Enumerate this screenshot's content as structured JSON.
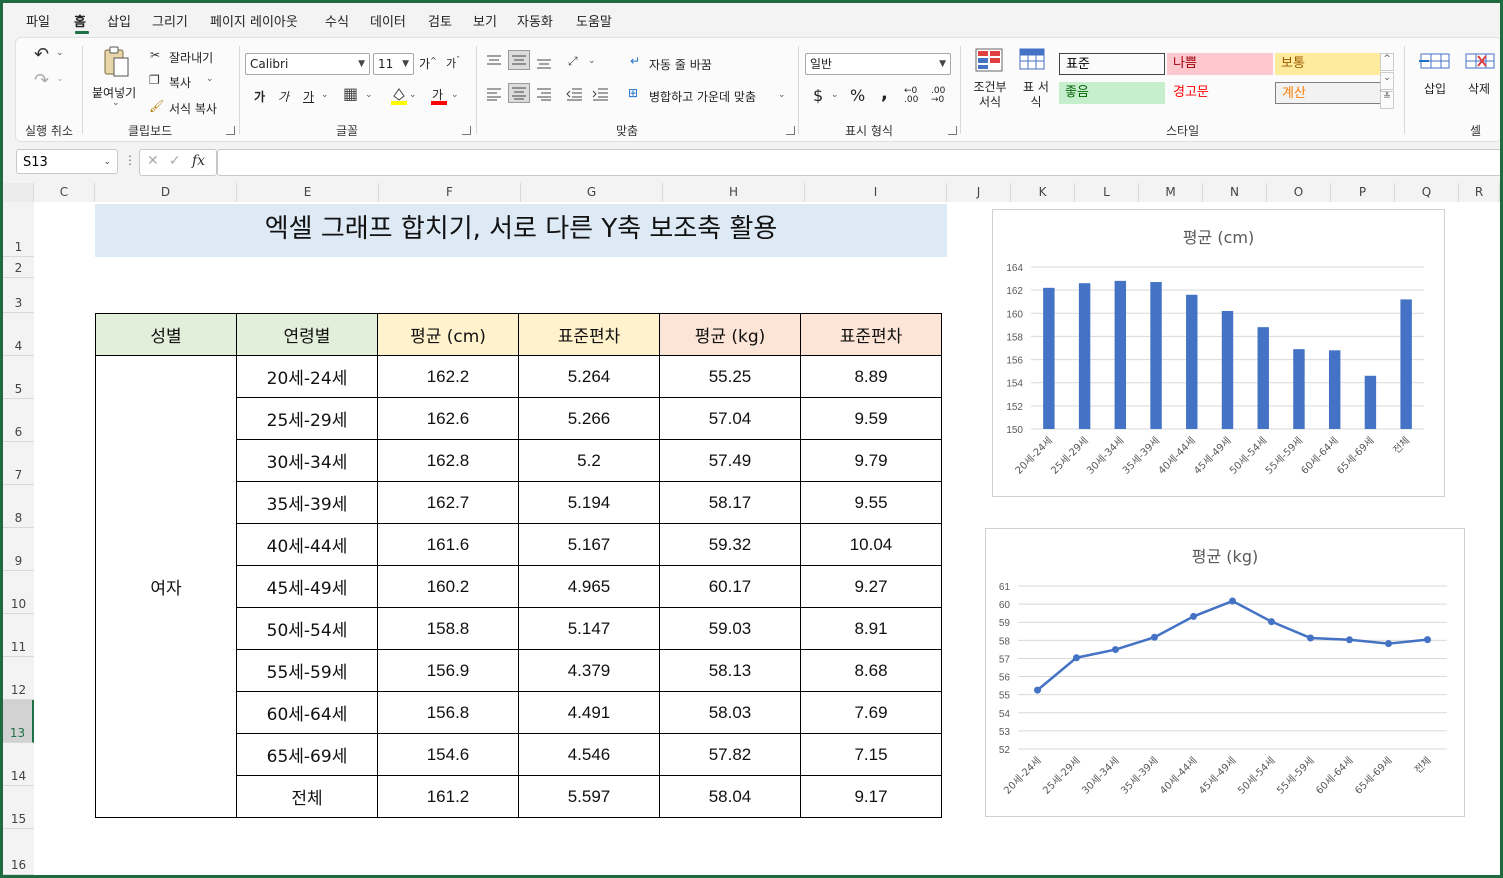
{
  "menu": [
    "파일",
    "홈",
    "삽입",
    "그리기",
    "페이지 레이아웃",
    "수식",
    "데이터",
    "검토",
    "보기",
    "자동화",
    "도움말"
  ],
  "ribbon": {
    "undo_group": "실행 취소",
    "clipboard": {
      "paste": "붙여넣기",
      "cut": "잘라내기",
      "copy": "복사",
      "format_painter": "서식 복사",
      "group": "클립보드"
    },
    "font": {
      "name": "Calibri",
      "size": "11",
      "group": "글꼴",
      "grow": "가",
      "shrink": "가",
      "bold": "가",
      "italic": "가",
      "underline": "가",
      "font_color_label": "가"
    },
    "alignment": {
      "wrap": "자동 줄 바꿈",
      "merge": "병합하고 가운데 맞춤",
      "group": "맞춤"
    },
    "number": {
      "format": "일반",
      "currency": "$",
      "percent": "%",
      "comma": ",",
      "group": "표시 형식"
    },
    "styles": {
      "conditional": "조건부 서식",
      "table": "표 서식",
      "cells": [
        {
          "label": "표준",
          "bg": "#ffffff",
          "color": "#000000"
        },
        {
          "label": "나쁨",
          "bg": "#ffc7ce",
          "color": "#9c0006"
        },
        {
          "label": "보통",
          "bg": "#ffeb9c",
          "color": "#9c5700"
        },
        {
          "label": "좋음",
          "bg": "#c6efce",
          "color": "#006100"
        },
        {
          "label": "경고문",
          "bg": "#ffffff",
          "color": "#ff0000"
        },
        {
          "label": "계산",
          "bg": "#f2f2f2",
          "color": "#fa7d00"
        }
      ],
      "group": "스타일"
    },
    "cells_group": {
      "insert": "삽입",
      "delete": "삭제",
      "group": "셀"
    }
  },
  "formula_bar": {
    "name_box": "S13",
    "fx": "fx",
    "value": ""
  },
  "columns": [
    "C",
    "D",
    "E",
    "F",
    "G",
    "H",
    "I",
    "J",
    "K",
    "L",
    "M",
    "N",
    "O",
    "P",
    "Q",
    "R"
  ],
  "rows": [
    "1",
    "2",
    "3",
    "4",
    "5",
    "6",
    "7",
    "8",
    "9",
    "10",
    "11",
    "12",
    "13",
    "14",
    "15",
    "16"
  ],
  "selected_row": "13",
  "sheet": {
    "title": "엑셀 그래프 합치기, 서로 다른 Y축 보조축 활용",
    "headers": [
      "성별",
      "연령별",
      "평균 (cm)",
      "표준편차",
      "평균 (kg)",
      "표준편차"
    ],
    "header_colors": [
      "#e2efda",
      "#e2efda",
      "#fff2cc",
      "#fff2cc",
      "#fce4d6",
      "#fce4d6"
    ],
    "gender": "여자",
    "rows": [
      [
        "20세-24세",
        "162.2",
        "5.264",
        "55.25",
        "8.89"
      ],
      [
        "25세-29세",
        "162.6",
        "5.266",
        "57.04",
        "9.59"
      ],
      [
        "30세-34세",
        "162.8",
        "5.2",
        "57.49",
        "9.79"
      ],
      [
        "35세-39세",
        "162.7",
        "5.194",
        "58.17",
        "9.55"
      ],
      [
        "40세-44세",
        "161.6",
        "5.167",
        "59.32",
        "10.04"
      ],
      [
        "45세-49세",
        "160.2",
        "4.965",
        "60.17",
        "9.27"
      ],
      [
        "50세-54세",
        "158.8",
        "5.147",
        "59.03",
        "8.91"
      ],
      [
        "55세-59세",
        "156.9",
        "4.379",
        "58.13",
        "8.68"
      ],
      [
        "60세-64세",
        "156.8",
        "4.491",
        "58.03",
        "7.69"
      ],
      [
        "65세-69세",
        "154.6",
        "4.546",
        "57.82",
        "7.15"
      ],
      [
        "전체",
        "161.2",
        "5.597",
        "58.04",
        "9.17"
      ]
    ]
  },
  "chart_data": [
    {
      "type": "bar",
      "title": "평균 (cm)",
      "categories": [
        "20세-24세",
        "25세-29세",
        "30세-34세",
        "35세-39세",
        "40세-44세",
        "45세-49세",
        "50세-54세",
        "55세-59세",
        "60세-64세",
        "65세-69세",
        "전체"
      ],
      "values": [
        162.2,
        162.6,
        162.8,
        162.7,
        161.6,
        160.2,
        158.8,
        156.9,
        156.8,
        154.6,
        161.2
      ],
      "ylim": [
        150,
        164
      ],
      "yticks": [
        150,
        152,
        154,
        156,
        158,
        160,
        162,
        164
      ],
      "grid": true,
      "color": "#4472c4"
    },
    {
      "type": "line",
      "title": "평균 (kg)",
      "categories": [
        "20세-24세",
        "25세-29세",
        "30세-34세",
        "35세-39세",
        "40세-44세",
        "45세-49세",
        "50세-54세",
        "55세-59세",
        "60세-64세",
        "65세-69세",
        "전체"
      ],
      "values": [
        55.25,
        57.04,
        57.49,
        58.17,
        59.32,
        60.17,
        59.03,
        58.13,
        58.03,
        57.82,
        58.04
      ],
      "ylim": [
        52,
        61
      ],
      "yticks": [
        52,
        53,
        54,
        55,
        56,
        57,
        58,
        59,
        60,
        61
      ],
      "grid": true,
      "color": "#4472c4"
    }
  ]
}
